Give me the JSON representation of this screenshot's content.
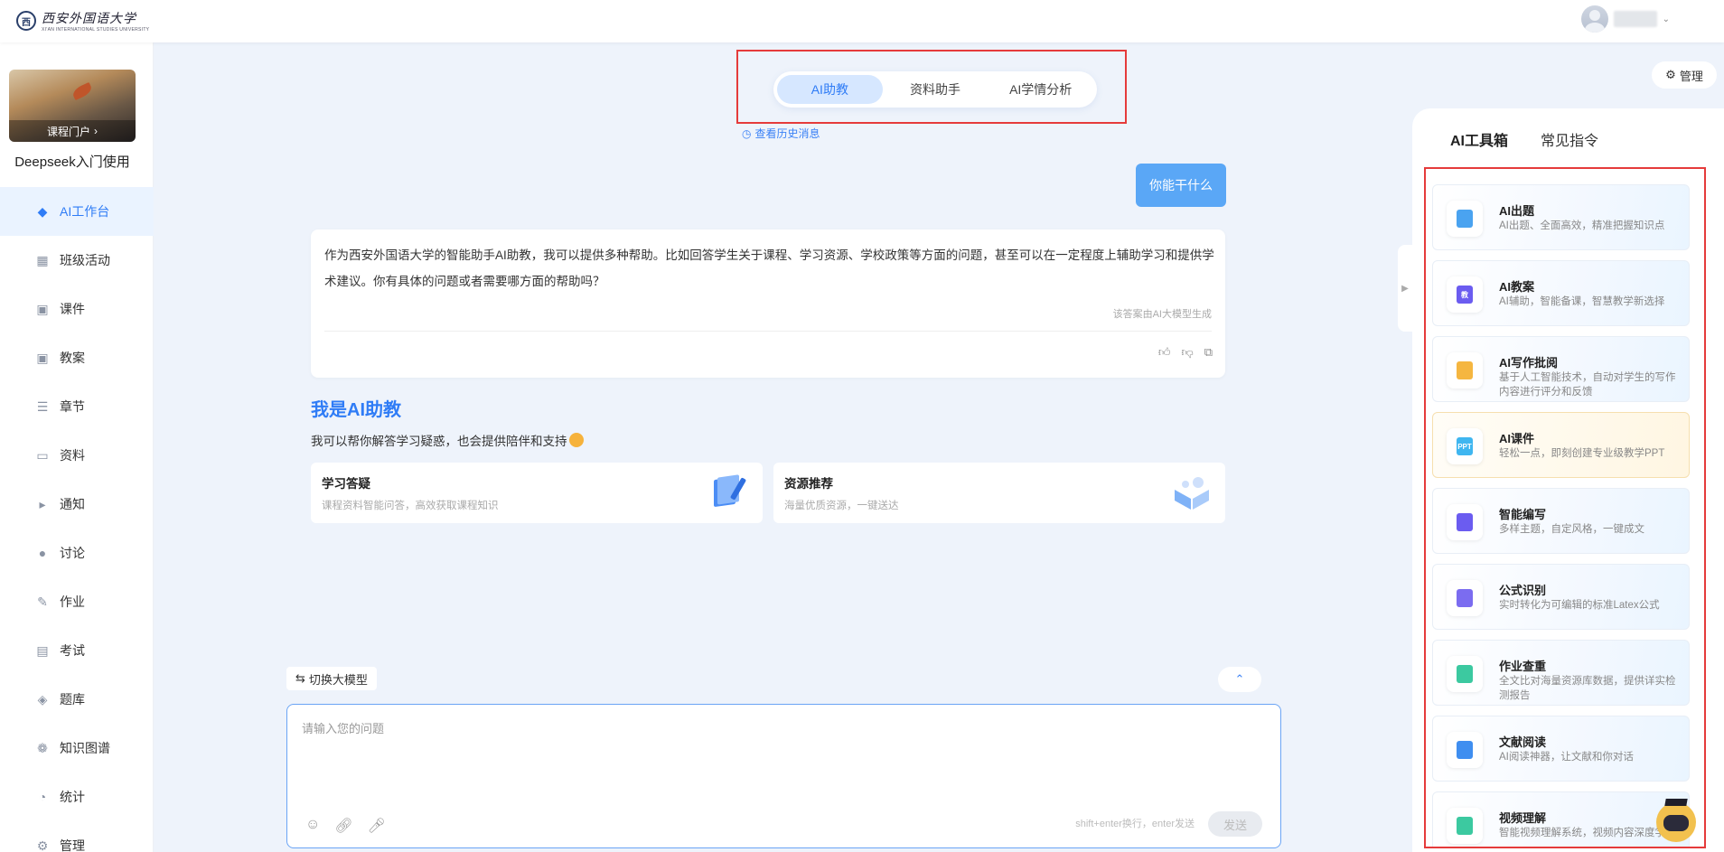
{
  "header": {
    "university_name": "西安外国语大学",
    "university_name_en": "XI'AN INTERNATIONAL STUDIES UNIVERSITY"
  },
  "sidebar": {
    "course_portal_label": "课程门户",
    "course_title": "Deepseek入门使用",
    "items": [
      {
        "label": "AI工作台",
        "icon": "ai-icon"
      },
      {
        "label": "班级活动",
        "icon": "grid-icon"
      },
      {
        "label": "课件",
        "icon": "ppt-file-icon"
      },
      {
        "label": "教案",
        "icon": "lesson-plan-icon"
      },
      {
        "label": "章节",
        "icon": "list-icon"
      },
      {
        "label": "资料",
        "icon": "folder-icon"
      },
      {
        "label": "通知",
        "icon": "megaphone-icon"
      },
      {
        "label": "讨论",
        "icon": "chat-icon"
      },
      {
        "label": "作业",
        "icon": "homework-icon"
      },
      {
        "label": "考试",
        "icon": "exam-icon"
      },
      {
        "label": "题库",
        "icon": "layers-icon"
      },
      {
        "label": "知识图谱",
        "icon": "graph-icon"
      },
      {
        "label": "统计",
        "icon": "pie-chart-icon"
      },
      {
        "label": "管理",
        "icon": "settings-icon"
      }
    ]
  },
  "main": {
    "mode_tabs": [
      {
        "label": "AI助教",
        "active": true
      },
      {
        "label": "资料助手",
        "active": false
      },
      {
        "label": "AI学情分析",
        "active": false
      }
    ],
    "history_link": "查看历史消息",
    "user_message": "你能干什么",
    "ai_answer": "作为西安外国语大学的智能助手AI助教，我可以提供多种帮助。比如回答学生关于课程、学习资源、学校政策等方面的问题，甚至可以在一定程度上辅助学习和提供学术建议。你有具体的问题或者需要哪方面的帮助吗？",
    "ai_note": "该答案由AI大模型生成",
    "intro_title": "我是AI助教",
    "intro_subtitle": "我可以帮你解答学习疑惑，也会提供陪伴和支持",
    "features": [
      {
        "title": "学习答疑",
        "desc": "课程资料智能问答，高效获取课程知识"
      },
      {
        "title": "资源推荐",
        "desc": "海量优质资源，一键送达"
      }
    ],
    "switch_model_label": "切换大模型",
    "input_placeholder": "请输入您的问题",
    "send_hint": "shift+enter换行，enter发送",
    "send_label": "发送"
  },
  "right_panel": {
    "manage_label": "管理",
    "tabs": [
      {
        "label": "AI工具箱",
        "active": true
      },
      {
        "label": "常见指令",
        "active": false
      }
    ],
    "tools": [
      {
        "name": "AI出题",
        "desc": "AI出题、全面高效，精准把握知识点",
        "color": "#4aa3f0",
        "glyph": ""
      },
      {
        "name": "AI教案",
        "desc": "AI辅助，智能备课，智慧教学新选择",
        "color": "#6b5cf0",
        "glyph": "教"
      },
      {
        "name": "AI写作批阅",
        "desc": "基于人工智能技术，自动对学生的写作内容进行评分和反馈",
        "color": "#f5b640",
        "glyph": ""
      },
      {
        "name": "AI课件",
        "desc": "轻松一点，即刻创建专业级教学PPT",
        "color": "#3fb6f0",
        "glyph": "PPT",
        "highlight": true
      },
      {
        "name": "智能编写",
        "desc": "多样主题，自定风格，一键成文",
        "color": "#6b5cf0",
        "glyph": ""
      },
      {
        "name": "公式识别",
        "desc": "实时转化为可编辑的标准Latex公式",
        "color": "#7b6cf0",
        "glyph": ""
      },
      {
        "name": "作业查重",
        "desc": "全文比对海量资源库数据，提供详实检测报告",
        "color": "#3cc9a0",
        "glyph": ""
      },
      {
        "name": "文献阅读",
        "desc": "AI阅读神器，让文献和你对话",
        "color": "#3f8ef0",
        "glyph": ""
      },
      {
        "name": "视频理解",
        "desc": "智能视频理解系统，视频内容深度学习",
        "color": "#3cc9a0",
        "glyph": ""
      }
    ]
  }
}
